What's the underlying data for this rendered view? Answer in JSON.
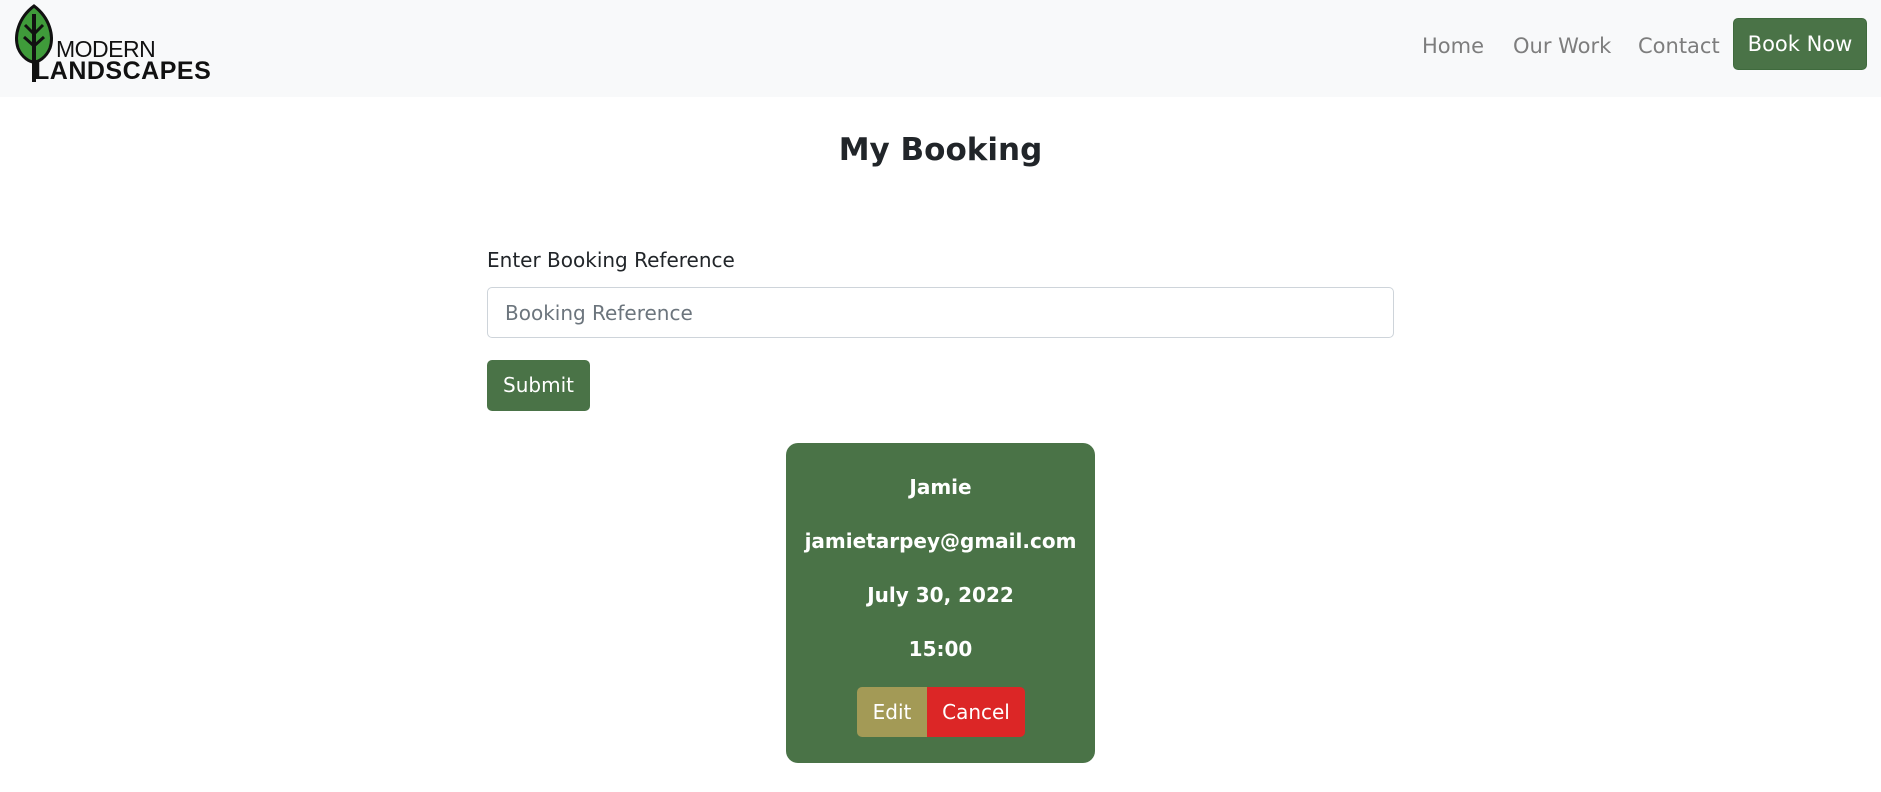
{
  "header": {
    "logo": {
      "line1": "MODERN",
      "line2": "LANDSCAPES",
      "icon": "leaf-icon"
    },
    "nav": [
      {
        "label": "Home"
      },
      {
        "label": "Our Work"
      },
      {
        "label": "Contact"
      }
    ],
    "cta_label": "Book Now"
  },
  "main": {
    "title": "My Booking",
    "form": {
      "label": "Enter Booking Reference",
      "input_value": "",
      "input_placeholder": "Booking Reference",
      "submit_label": "Submit"
    },
    "booking": {
      "name": "Jamie",
      "email": "jamietarpey@gmail.com",
      "date": "July 30, 2022",
      "time": "15:00",
      "edit_label": "Edit",
      "cancel_label": "Cancel"
    }
  },
  "colors": {
    "brand_green": "#4a7347",
    "edit_olive": "#a39a56",
    "cancel_red": "#dc2626",
    "navbar_bg": "#f8f9fa",
    "nav_link": "#7d7d7d"
  }
}
